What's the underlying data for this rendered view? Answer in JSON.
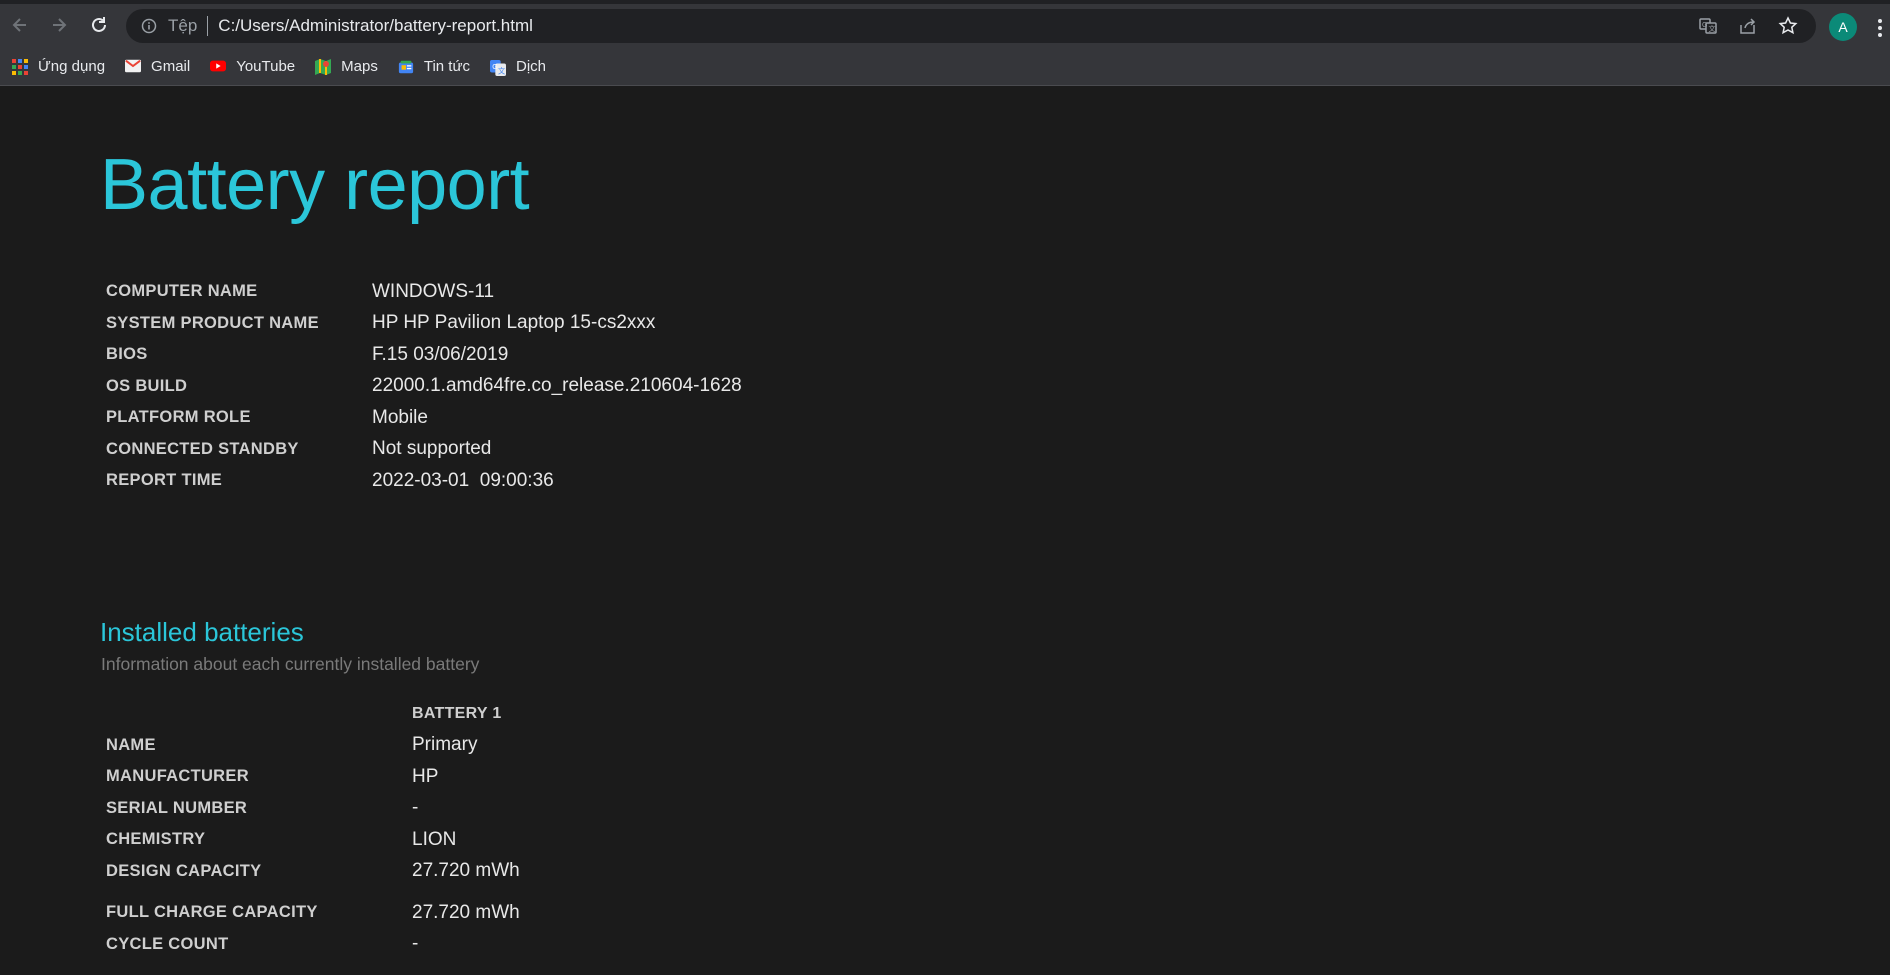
{
  "browser": {
    "scheme_label": "Tệp",
    "url": "C:/Users/Administrator/battery-report.html",
    "avatar_letter": "A",
    "avatar_color": "#0b8a78",
    "bookmarks": [
      {
        "label": "Ứng dụng",
        "icon": "apps-grid-icon"
      },
      {
        "label": "Gmail",
        "icon": "gmail-icon"
      },
      {
        "label": "YouTube",
        "icon": "youtube-icon"
      },
      {
        "label": "Maps",
        "icon": "maps-icon"
      },
      {
        "label": "Tin tức",
        "icon": "news-icon"
      },
      {
        "label": "Dịch",
        "icon": "translate-icon"
      }
    ]
  },
  "report": {
    "title": "Battery report",
    "accent_color": "#2bc6d9",
    "system_info": [
      {
        "label": "COMPUTER NAME",
        "value": "WINDOWS-11"
      },
      {
        "label": "SYSTEM PRODUCT NAME",
        "value": "HP HP Pavilion Laptop 15-cs2xxx"
      },
      {
        "label": "BIOS",
        "value": "F.15 03/06/2019"
      },
      {
        "label": "OS BUILD",
        "value": "22000.1.amd64fre.co_release.210604-1628"
      },
      {
        "label": "PLATFORM ROLE",
        "value": "Mobile"
      },
      {
        "label": "CONNECTED STANDBY",
        "value": "Not supported"
      },
      {
        "label": "REPORT TIME",
        "value": "2022-03-01  09:00:36"
      }
    ],
    "installed_batteries": {
      "heading": "Installed batteries",
      "subtitle": "Information about each currently installed battery",
      "column_header": "BATTERY 1",
      "rows": [
        {
          "label": "NAME",
          "value": "Primary"
        },
        {
          "label": "MANUFACTURER",
          "value": "HP"
        },
        {
          "label": "SERIAL NUMBER",
          "value": "-"
        },
        {
          "label": "CHEMISTRY",
          "value": "LION"
        },
        {
          "label": "DESIGN CAPACITY",
          "value": "27.720 mWh"
        },
        {
          "label": "FULL CHARGE CAPACITY",
          "value": "27.720 mWh"
        },
        {
          "label": "CYCLE COUNT",
          "value": "-"
        }
      ]
    }
  }
}
